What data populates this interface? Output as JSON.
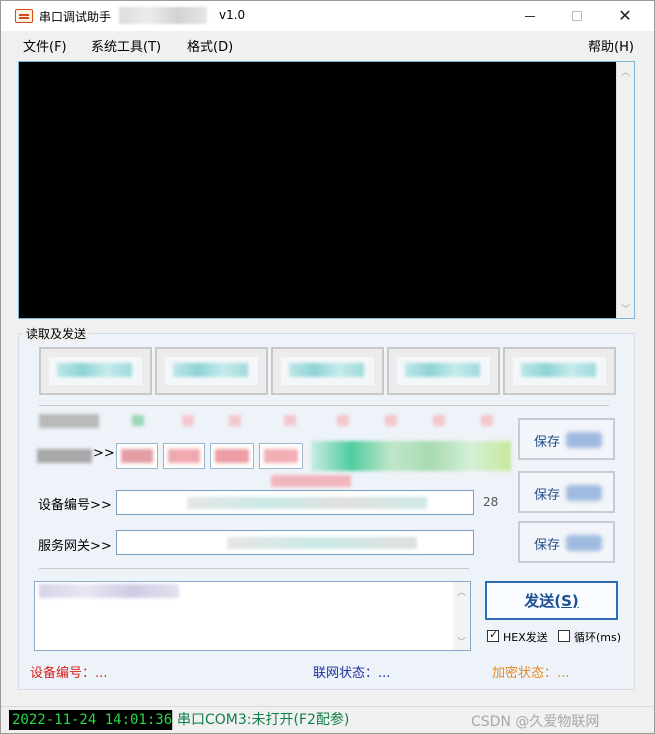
{
  "window": {
    "title": "串口调试助手",
    "version": "v1.0"
  },
  "menu": {
    "file": "文件(F)",
    "tools": "系统工具(T)",
    "format": "格式(D)",
    "help": "帮助(H)"
  },
  "group": {
    "legend": "读取及发送"
  },
  "fields": {
    "device_id_label": "设备编号>>",
    "device_id_length": "28",
    "gateway_label": "服务网关>>",
    "row2_suffix": ">>"
  },
  "buttons": {
    "save_label": "保存",
    "send_label": "发送",
    "send_hotkey": "(S)"
  },
  "options": {
    "hex_send": "HEX发送",
    "hex_send_checked": true,
    "loop": "循环(ms)",
    "loop_checked": false
  },
  "status": {
    "device_id": "设备编号：...",
    "network": "联网状态：...",
    "encryption": "加密状态：..."
  },
  "colors": {
    "device_status": "#d8231f",
    "network_status": "#1d2fa0",
    "encryption_status": "#e38b1e",
    "clock_text": "#2bd84a",
    "port_text": "#12804a"
  },
  "statusbar": {
    "clock": "2022-11-24 14:01:36",
    "port": "串口COM3:未打开(F2配参)",
    "watermark": "CSDN @久爱物联网"
  },
  "icons": {
    "app": "serial-port-app-icon",
    "minimize": "minimize-icon",
    "maximize": "maximize-icon",
    "close": "close-icon"
  }
}
